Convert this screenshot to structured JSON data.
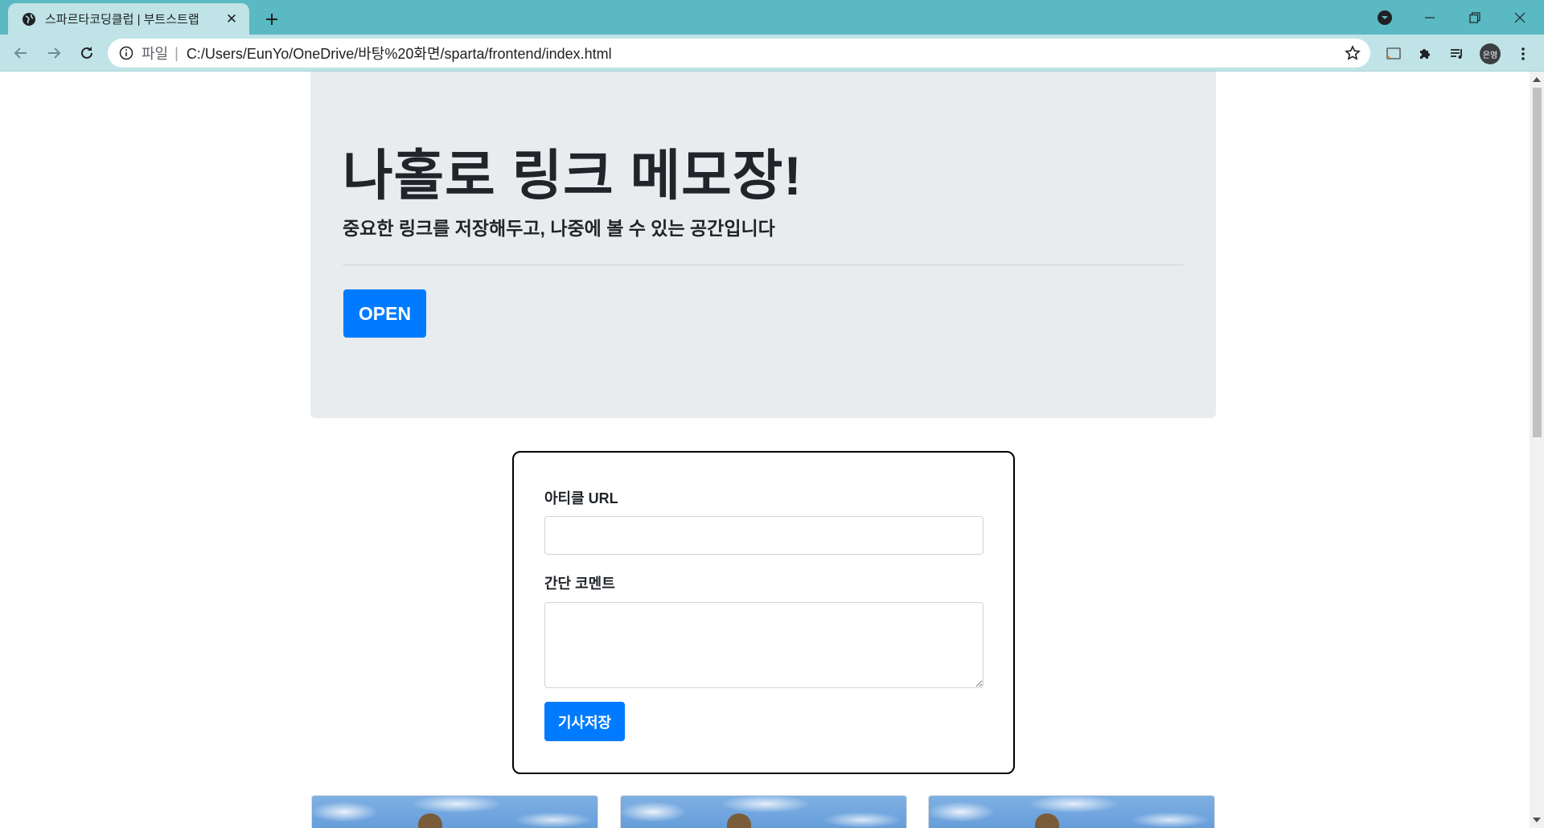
{
  "browser": {
    "tab_title": "스파르타코딩클럽 | 부트스트랩",
    "url_scheme": "파일",
    "url_separator": "|",
    "url": "C:/Users/EunYo/OneDrive/바탕%20화면/sparta/frontend/index.html",
    "profile_initials": "은영"
  },
  "jumbotron": {
    "title": "나홀로 링크 메모장!",
    "lead": "중요한 링크를 저장해두고, 나중에 볼 수 있는 공간입니다",
    "open_button": "OPEN"
  },
  "form": {
    "url_label": "아티클 URL",
    "url_value": "",
    "comment_label": "간단 코멘트",
    "comment_value": "",
    "save_button": "기사저장"
  },
  "colors": {
    "titlebar": "#5ab9c2",
    "toolbar": "#bfe3e6",
    "primary": "#007bff",
    "jumbotron_bg": "#e9ecef"
  }
}
